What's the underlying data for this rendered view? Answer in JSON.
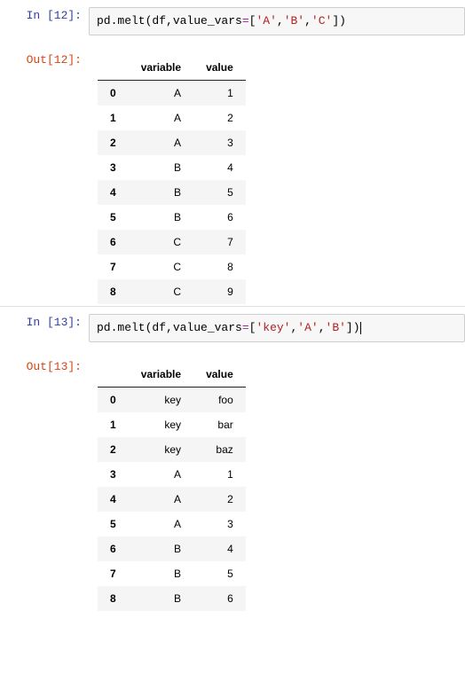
{
  "cells": [
    {
      "in_prompt": "In  [12]:",
      "out_prompt": "Out[12]:",
      "code_tokens": {
        "fn": "pd.melt",
        "lp": "(",
        "arg1": "df,",
        "kw": "value_vars",
        "eq": "=",
        "lb": "[",
        "s1": "'A'",
        "c1": ",",
        "s2": "'B'",
        "c2": ",",
        "s3": "'C'",
        "rb": "]",
        "rp": ")"
      },
      "columns": [
        "variable",
        "value"
      ],
      "index": [
        "0",
        "1",
        "2",
        "3",
        "4",
        "5",
        "6",
        "7",
        "8"
      ],
      "rows": [
        [
          "A",
          "1"
        ],
        [
          "A",
          "2"
        ],
        [
          "A",
          "3"
        ],
        [
          "B",
          "4"
        ],
        [
          "B",
          "5"
        ],
        [
          "B",
          "6"
        ],
        [
          "C",
          "7"
        ],
        [
          "C",
          "8"
        ],
        [
          "C",
          "9"
        ]
      ]
    },
    {
      "in_prompt": "In  [13]:",
      "out_prompt": "Out[13]:",
      "code_tokens": {
        "fn": "pd.melt",
        "lp": "(",
        "arg1": "df,",
        "kw": "value_vars",
        "eq": "=",
        "lb": "[",
        "s1": "'key'",
        "c1": ",",
        "s2": "'A'",
        "c2": ",",
        "s3": "'B'",
        "rb": "]",
        "rp": ")"
      },
      "has_cursor": true,
      "columns": [
        "variable",
        "value"
      ],
      "index": [
        "0",
        "1",
        "2",
        "3",
        "4",
        "5",
        "6",
        "7",
        "8"
      ],
      "rows": [
        [
          "key",
          "foo"
        ],
        [
          "key",
          "bar"
        ],
        [
          "key",
          "baz"
        ],
        [
          "A",
          "1"
        ],
        [
          "A",
          "2"
        ],
        [
          "A",
          "3"
        ],
        [
          "B",
          "4"
        ],
        [
          "B",
          "5"
        ],
        [
          "B",
          "6"
        ]
      ]
    }
  ],
  "chart_data": [
    {
      "type": "table",
      "title": "pd.melt(df, value_vars=['A','B','C'])",
      "columns": [
        "",
        "variable",
        "value"
      ],
      "rows": [
        [
          "0",
          "A",
          "1"
        ],
        [
          "1",
          "A",
          "2"
        ],
        [
          "2",
          "A",
          "3"
        ],
        [
          "3",
          "B",
          "4"
        ],
        [
          "4",
          "B",
          "5"
        ],
        [
          "5",
          "B",
          "6"
        ],
        [
          "6",
          "C",
          "7"
        ],
        [
          "7",
          "C",
          "8"
        ],
        [
          "8",
          "C",
          "9"
        ]
      ]
    },
    {
      "type": "table",
      "title": "pd.melt(df, value_vars=['key','A','B'])",
      "columns": [
        "",
        "variable",
        "value"
      ],
      "rows": [
        [
          "0",
          "key",
          "foo"
        ],
        [
          "1",
          "key",
          "bar"
        ],
        [
          "2",
          "key",
          "baz"
        ],
        [
          "3",
          "A",
          "1"
        ],
        [
          "4",
          "A",
          "2"
        ],
        [
          "5",
          "A",
          "3"
        ],
        [
          "6",
          "B",
          "4"
        ],
        [
          "7",
          "B",
          "5"
        ],
        [
          "8",
          "B",
          "6"
        ]
      ]
    }
  ]
}
